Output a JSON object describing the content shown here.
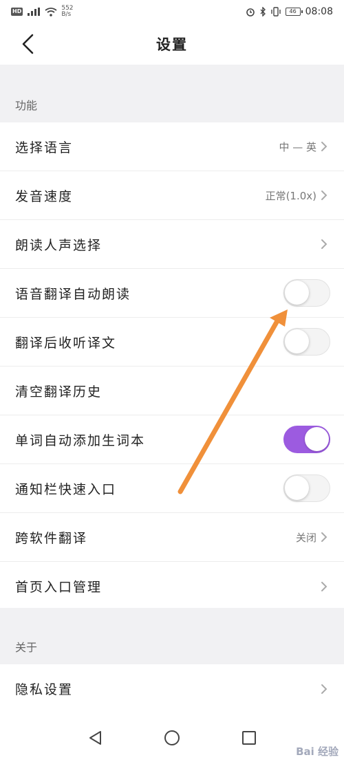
{
  "status_bar": {
    "hd": "HD",
    "signal": "⁴ᴳ",
    "net_speed_value": "552",
    "net_speed_unit": "B/s",
    "battery": "46",
    "time": "08:08"
  },
  "header": {
    "title": "设置"
  },
  "sections": {
    "functions": {
      "title": "功能"
    },
    "about": {
      "title": "关于"
    }
  },
  "rows": {
    "language": {
      "label": "选择语言",
      "value": "中 — 英"
    },
    "speed": {
      "label": "发音速度",
      "value": "正常(1.0x)"
    },
    "voice": {
      "label": "朗读人声选择"
    },
    "auto_read": {
      "label": "语音翻译自动朗读",
      "toggle": "off"
    },
    "listen": {
      "label": "翻译后收听译文",
      "toggle": "off"
    },
    "clear": {
      "label": "清空翻译历史"
    },
    "add_words": {
      "label": "单词自动添加生词本",
      "toggle": "on"
    },
    "notify": {
      "label": "通知栏快速入口",
      "toggle": "off"
    },
    "cross_app": {
      "label": "跨软件翻译",
      "value": "关闭"
    },
    "home_entry": {
      "label": "首页入口管理"
    },
    "privacy": {
      "label": "隐私设置"
    }
  },
  "colors": {
    "accent": "#9c5be0",
    "annotation_arrow": "#f0903a",
    "page_bg": "#f1f1f3"
  },
  "watermark": {
    "text": "Bai 经验"
  }
}
